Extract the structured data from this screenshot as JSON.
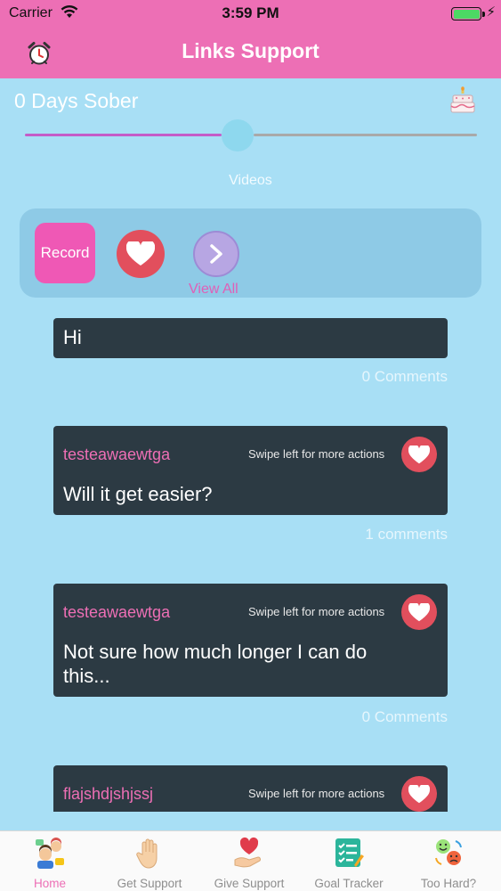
{
  "status_bar": {
    "carrier": "Carrier",
    "time": "3:59 PM"
  },
  "nav": {
    "title": "Links Support",
    "left_icon": "alarm-clock-icon"
  },
  "sober": {
    "text": "0 Days Sober",
    "icon": "cake-icon",
    "slider_progress": 0.47
  },
  "videos": {
    "label": "Videos",
    "record_label": "Record",
    "view_all_label": "View All"
  },
  "posts": [
    {
      "author": "",
      "hint": "",
      "message": "Hi",
      "comments": "0 Comments"
    },
    {
      "author": "testeawaewtga",
      "hint": "Swipe left for more actions",
      "message": "Will it get easier?",
      "comments": "1 comments"
    },
    {
      "author": "testeawaewtga",
      "hint": "Swipe left for more actions",
      "message": "Not sure how much longer I can do this...",
      "comments": "0 Comments"
    },
    {
      "author": "flajshdjshjssj",
      "hint": "Swipe left for more actions",
      "message": "",
      "comments": ""
    }
  ],
  "tabs": [
    {
      "label": "Home",
      "icon": "home-people-icon",
      "active": true
    },
    {
      "label": "Get Support",
      "icon": "raised-hand-icon",
      "active": false
    },
    {
      "label": "Give Support",
      "icon": "heart-in-hand-icon",
      "active": false
    },
    {
      "label": "Goal Tracker",
      "icon": "checklist-icon",
      "active": false
    },
    {
      "label": "Too Hard?",
      "icon": "mood-faces-icon",
      "active": false
    }
  ],
  "colors": {
    "header": "#ed6fb5",
    "background": "#a8dff5",
    "card": "#2c3a43",
    "heart_button": "#e24f5d",
    "record_button": "#ef58b5"
  }
}
